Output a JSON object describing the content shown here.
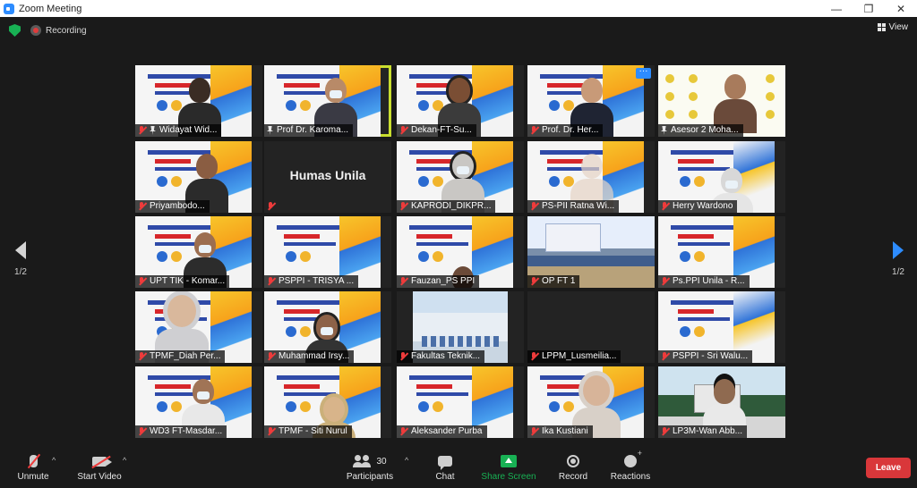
{
  "window": {
    "title": "Zoom Meeting",
    "minimize": "—",
    "restore": "❐",
    "close": "✕"
  },
  "status": {
    "recording_label": "Recording",
    "view_label": "View"
  },
  "pager": {
    "left_page": "1/2",
    "right_page": "1/2"
  },
  "tiles": [
    {
      "name": "Widayat Wid..."
    },
    {
      "name": "Prof Dr. Karoma..."
    },
    {
      "name": "Dekan-FT-Su..."
    },
    {
      "name": "Prof. Dr. Her..."
    },
    {
      "name": "Asesor 2 Moha..."
    },
    {
      "name": "Priyambodo..."
    },
    {
      "name": "",
      "big_text": "Humas Unila"
    },
    {
      "name": "KAPRODI_DIKPR..."
    },
    {
      "name": "PS-PII Ratna Wi..."
    },
    {
      "name": "Herry Wardono"
    },
    {
      "name": "UPT TIK - Komar..."
    },
    {
      "name": "PSPPI - TRISYA ..."
    },
    {
      "name": "Fauzan_PS PPI"
    },
    {
      "name": "OP FT 1"
    },
    {
      "name": "Ps.PPI Unila - R..."
    },
    {
      "name": "TPMF_Diah Per..."
    },
    {
      "name": "Muhammad Irsy..."
    },
    {
      "name": "Fakultas Teknik..."
    },
    {
      "name": "LPPM_Lusmeilia..."
    },
    {
      "name": "PSPPI - Sri Walu..."
    },
    {
      "name": "WD3 FT-Masdar..."
    },
    {
      "name": "TPMF - Siti Nurul"
    },
    {
      "name": "Aleksander Purba"
    },
    {
      "name": "Ika Kustiani"
    },
    {
      "name": "LP3M-Wan Abb..."
    }
  ],
  "toolbar": {
    "unmute": "Unmute",
    "start_video": "Start Video",
    "participants": "Participants",
    "participants_count": "30",
    "chat": "Chat",
    "share_screen": "Share Screen",
    "record": "Record",
    "reactions": "Reactions",
    "leave": "Leave",
    "caret": "^"
  },
  "colors": {
    "accent": "#2d8cff",
    "active_speaker": "#c9de2f",
    "leave": "#d9373a",
    "share": "#18b154",
    "muted": "#ee3b3b"
  }
}
